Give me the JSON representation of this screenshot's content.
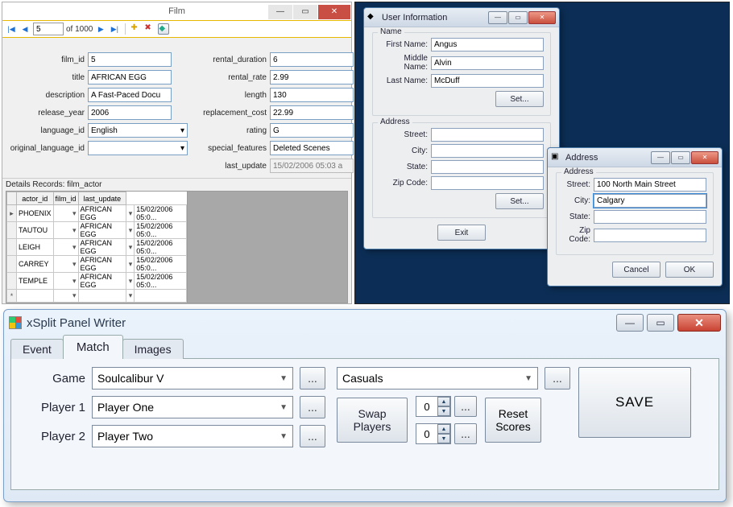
{
  "film": {
    "title": "Film",
    "nav": {
      "page": "5",
      "of_label": "of 1000"
    },
    "fields": {
      "film_id": {
        "label": "film_id",
        "value": "5"
      },
      "title": {
        "label": "title",
        "value": "AFRICAN EGG"
      },
      "description": {
        "label": "description",
        "value": "A Fast-Paced Docu"
      },
      "release_year": {
        "label": "release_year",
        "value": "2006"
      },
      "language_id": {
        "label": "language_id",
        "value": "English"
      },
      "original_language_id": {
        "label": "original_language_id",
        "value": ""
      },
      "rental_duration": {
        "label": "rental_duration",
        "value": "6"
      },
      "rental_rate": {
        "label": "rental_rate",
        "value": "2.99"
      },
      "length": {
        "label": "length",
        "value": "130"
      },
      "replacement_cost": {
        "label": "replacement_cost",
        "value": "22.99"
      },
      "rating": {
        "label": "rating",
        "value": "G"
      },
      "special_features": {
        "label": "special_features",
        "value": "Deleted Scenes"
      },
      "last_update": {
        "label": "last_update",
        "value": "15/02/2006 05:03 a"
      }
    },
    "details_label": "Details Records: film_actor",
    "grid": {
      "cols": [
        "actor_id",
        "film_id",
        "last_update"
      ],
      "rows": [
        {
          "actor_id": "PHOENIX",
          "film_id": "AFRICAN EGG",
          "last_update": "15/02/2006 05:0..."
        },
        {
          "actor_id": "TAUTOU",
          "film_id": "AFRICAN EGG",
          "last_update": "15/02/2006 05:0..."
        },
        {
          "actor_id": "LEIGH",
          "film_id": "AFRICAN EGG",
          "last_update": "15/02/2006 05:0..."
        },
        {
          "actor_id": "CARREY",
          "film_id": "AFRICAN EGG",
          "last_update": "15/02/2006 05:0..."
        },
        {
          "actor_id": "TEMPLE",
          "film_id": "AFRICAN EGG",
          "last_update": "15/02/2006 05:0..."
        }
      ]
    }
  },
  "userinfo": {
    "title": "User Information",
    "name_legend": "Name",
    "first_label": "First Name:",
    "first_value": "Angus",
    "middle_label": "Middle Name:",
    "middle_value": "Alvin",
    "last_label": "Last Name:",
    "last_value": "McDuff",
    "set_label": "Set...",
    "address_legend": "Address",
    "street_label": "Street:",
    "street_value": "",
    "city_label": "City:",
    "city_value": "",
    "state_label": "State:",
    "state_value": "",
    "zip_label": "Zip Code:",
    "zip_value": "",
    "exit_label": "Exit"
  },
  "addr": {
    "title": "Address",
    "address_legend": "Address",
    "street_label": "Street:",
    "street_value": "100 North Main Street",
    "city_label": "City:",
    "city_value": "Calgary",
    "state_label": "State:",
    "state_value": "",
    "zip_label": "Zip Code:",
    "zip_value": "",
    "cancel_label": "Cancel",
    "ok_label": "OK"
  },
  "xsplit": {
    "title": "xSplit Panel Writer",
    "tabs": {
      "event": "Event",
      "match": "Match",
      "images": "Images"
    },
    "game_label": "Game",
    "game_value": "Soulcalibur V",
    "p1_label": "Player 1",
    "p1_value": "Player One",
    "p2_label": "Player 2",
    "p2_value": "Player Two",
    "round_value": "Casuals",
    "swap_label": "Swap Players",
    "reset_label": "Reset Scores",
    "save_label": "SAVE",
    "score1": "0",
    "score2": "0",
    "ellipsis": "..."
  }
}
